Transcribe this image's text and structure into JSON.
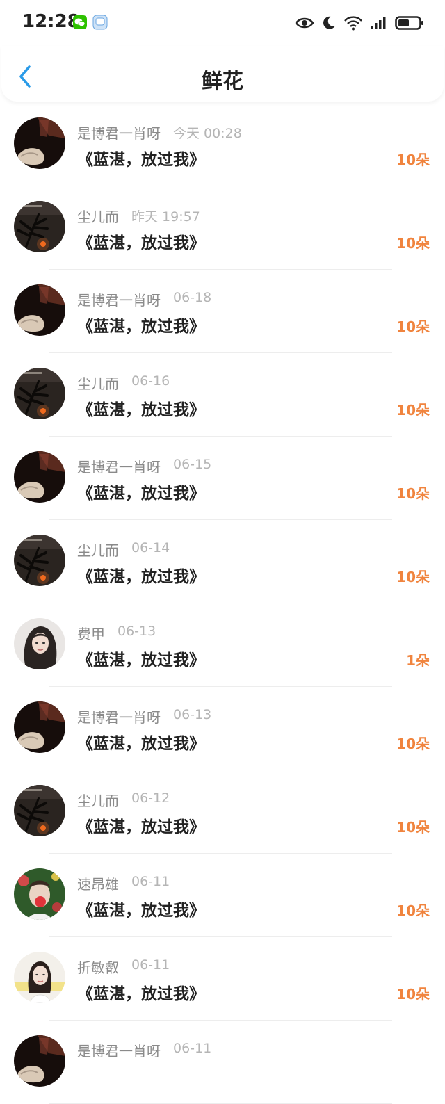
{
  "status_bar": {
    "time": "12:28",
    "left_icons": [
      "wechat-icon",
      "chat-app-icon"
    ],
    "right_icons": [
      "eye-icon",
      "moon-icon",
      "wifi-icon",
      "signal-icon",
      "battery-icon"
    ]
  },
  "header": {
    "title": "鲜花",
    "back_icon": "chevron-left-icon"
  },
  "colors": {
    "accent_back": "#2a9be8",
    "count": "#f0843e",
    "name": "#8a8a8a",
    "time": "#b5b5b5",
    "title": "#222222"
  },
  "items": [
    {
      "name": "是博君一肖呀",
      "time": "今天 00:28",
      "book": "《蓝湛，放过我》",
      "count": "10朵",
      "avatar": "dark-hand"
    },
    {
      "name": "尘儿而",
      "time": "昨天 19:57",
      "book": "《蓝湛，放过我》",
      "count": "10朵",
      "avatar": "dark-plant"
    },
    {
      "name": "是博君一肖呀",
      "time": "06-18",
      "book": "《蓝湛，放过我》",
      "count": "10朵",
      "avatar": "dark-hand"
    },
    {
      "name": "尘儿而",
      "time": "06-16",
      "book": "《蓝湛，放过我》",
      "count": "10朵",
      "avatar": "dark-plant"
    },
    {
      "name": "是博君一肖呀",
      "time": "06-15",
      "book": "《蓝湛，放过我》",
      "count": "10朵",
      "avatar": "dark-hand"
    },
    {
      "name": "尘儿而",
      "time": "06-14",
      "book": "《蓝湛，放过我》",
      "count": "10朵",
      "avatar": "dark-plant"
    },
    {
      "name": "费甲",
      "time": "06-13",
      "book": "《蓝湛，放过我》",
      "count": "1朵",
      "avatar": "portrait-woman"
    },
    {
      "name": "是博君一肖呀",
      "time": "06-13",
      "book": "《蓝湛，放过我》",
      "count": "10朵",
      "avatar": "dark-hand"
    },
    {
      "name": "尘儿而",
      "time": "06-12",
      "book": "《蓝湛，放过我》",
      "count": "10朵",
      "avatar": "dark-plant"
    },
    {
      "name": "速昂雄",
      "time": "06-11",
      "book": "《蓝湛，放过我》",
      "count": "10朵",
      "avatar": "portrait-man-rose"
    },
    {
      "name": "折敏叡",
      "time": "06-11",
      "book": "《蓝湛，放过我》",
      "count": "10朵",
      "avatar": "portrait-girl"
    },
    {
      "name": "是博君一肖呀",
      "time": "06-11",
      "book": "",
      "count": "",
      "avatar": "dark-hand"
    }
  ]
}
